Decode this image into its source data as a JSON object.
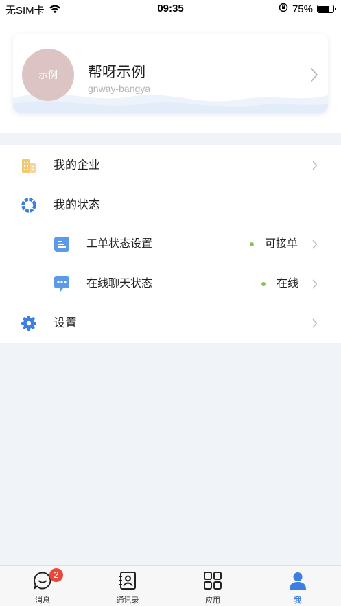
{
  "status_bar": {
    "carrier": "无SIM卡",
    "time": "09:35",
    "battery": "75%",
    "battery_level": 0.75
  },
  "profile": {
    "avatar_text": "示例",
    "name": "帮呀示例",
    "account": "gnway-bangya"
  },
  "menu": {
    "my_company": "我的企业",
    "my_status": "我的状态",
    "ticket_status": {
      "label": "工单状态设置",
      "value": "可接单"
    },
    "chat_status": {
      "label": "在线聊天状态",
      "value": "在线"
    },
    "settings": "设置"
  },
  "tabbar": {
    "messages": {
      "label": "消息",
      "badge": "2"
    },
    "contacts": {
      "label": "通讯录"
    },
    "apps": {
      "label": "应用"
    },
    "me": {
      "label": "我"
    }
  },
  "colors": {
    "accent": "#3d7fe0",
    "status_online": "#8bc34a",
    "badge": "#e8473b",
    "company_icon": "#f0c877"
  }
}
